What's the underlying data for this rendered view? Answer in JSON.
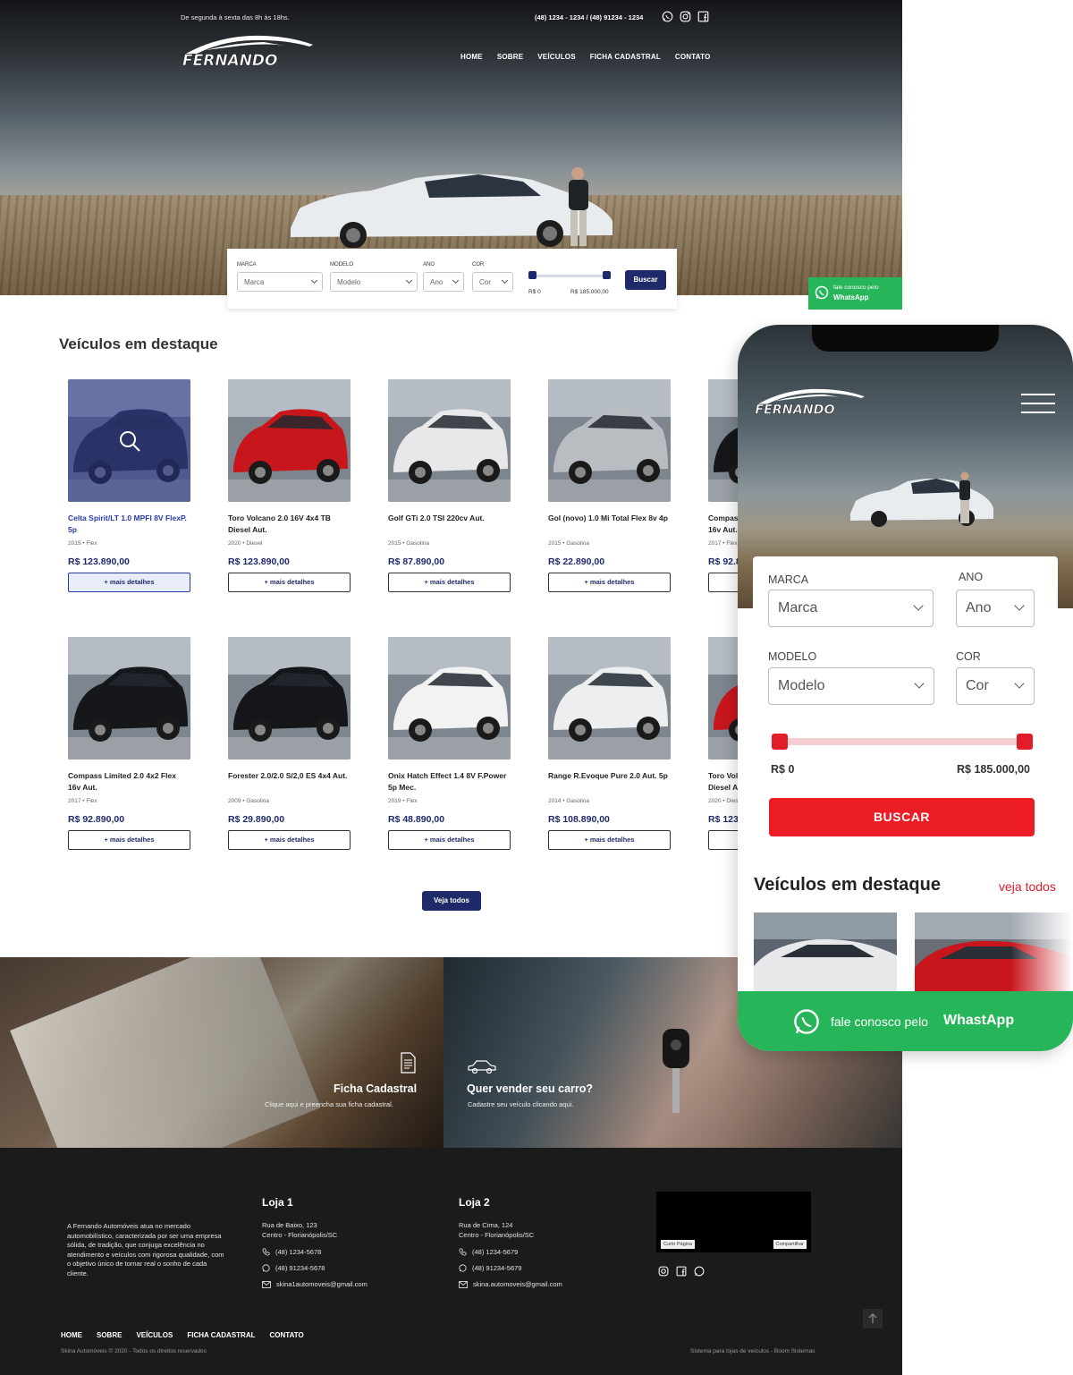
{
  "header": {
    "hours": "De segunda à sexta das 8h às 18hs.",
    "phones": "(48) 1234 - 1234 / (48) 91234 - 1234",
    "social_icons": [
      "whatsapp-icon",
      "instagram-icon",
      "facebook-icon"
    ],
    "logo_text": "FERNANDO",
    "nav": [
      "HOME",
      "SOBRE",
      "VEÍCULOS",
      "FICHA CADASTRAL",
      "CONTATO"
    ]
  },
  "search": {
    "marca_label": "MARCA",
    "marca_value": "Marca",
    "modelo_label": "MODELO",
    "modelo_value": "Modelo",
    "ano_label": "ANO",
    "ano_value": "Ano",
    "cor_label": "COR",
    "cor_value": "Cor",
    "price_min": "R$ 0",
    "price_max": "R$ 185.000,00",
    "button": "Buscar"
  },
  "whatsapp": {
    "line1": "fale conosco pelo",
    "line2": "WhatsApp"
  },
  "featured": {
    "title": "Veículos em destaque",
    "details_label": "+ mais detalhes",
    "view_all": "Veja todos",
    "cars": [
      {
        "name": "Celta Spirit/LT 1.0 MPFI 8V FlexP. 5p",
        "meta": "2015 • Flex",
        "price": "R$ 123.890,00",
        "color": "#2b2f3a"
      },
      {
        "name": "Toro Volcano 2.0 16V 4x4 TB Diesel Aut.",
        "meta": "2020 • Diesel",
        "price": "R$ 123.890,00",
        "color": "#c8161d"
      },
      {
        "name": "Golf GTi 2.0 TSI 220cv Aut.",
        "meta": "2015 • Gasolina",
        "price": "R$ 87.890,00",
        "color": "#e8e8ea"
      },
      {
        "name": "Gol (novo) 1.0 Mi Total Flex 8v 4p",
        "meta": "2015 • Gasolina",
        "price": "R$ 22.890,00",
        "color": "#b9bcc0"
      },
      {
        "name": "Compass Limited 2.0 4x2 Flex 16v Aut.",
        "meta": "2017 • Flex",
        "price": "R$ 92.890,00",
        "color": "#16171a"
      },
      {
        "name": "Compass Limited 2.0 4x2 Flex 16v Aut.",
        "meta": "2017 • Flex",
        "price": "R$ 92.890,00",
        "color": "#16171a"
      },
      {
        "name": "Forester 2.0/2.0 S/2,0 ES 4x4 Aut.",
        "meta": "2009 • Gasolina",
        "price": "R$ 29.890,00",
        "color": "#15161a"
      },
      {
        "name": "Onix Hatch Effect 1.4 8V F.Power 5p Mec.",
        "meta": "2019 • Flex",
        "price": "R$ 48.890,00",
        "color": "#f2f2f2"
      },
      {
        "name": "Range R.Evoque Pure 2.0 Aut. 5p",
        "meta": "2014 • Gasolina",
        "price": "R$ 108.890,00",
        "color": "#eceeef"
      },
      {
        "name": "Toro Volcano 2.0 16V 4x4 TB Diesel Aut.",
        "meta": "2020 • Diesel",
        "price": "R$ 123.890,00",
        "color": "#c8161d"
      }
    ]
  },
  "cta": {
    "left_title": "Ficha Cadastral",
    "left_sub": "Clique aqui e preencha sua ficha cadastral.",
    "right_title": "Quer vender seu carro?",
    "right_sub": "Cadastre seu veículo clicando aqui."
  },
  "footer": {
    "about": "A Fernando Automóveis atua no mercado automobilístico, caracterizada por ser uma empresa sólida, de tradição, que conjuga excelência no atendimento e veículos com rigorosa qualidade, com o objetivo único de tornar real o sonho de cada cliente.",
    "store1": {
      "title": "Loja 1",
      "addr1": "Rua de Baixo, 123",
      "addr2": "Centro - Florianópolis/SC",
      "phone": "(48) 1234-5678",
      "whats": "(48) 91234-5678",
      "email": "skina1automoveis@gmail.com"
    },
    "store2": {
      "title": "Loja 2",
      "addr1": "Rua de Cima, 124",
      "addr2": "Centro - Florianópolis/SC",
      "phone": "(48) 1234-5679",
      "whats": "(48) 91234-5679",
      "email": "skina.automoveis@gmail.com"
    },
    "fb_like": "Curtir Página",
    "fb_share": "Compartilhar",
    "nav": [
      "HOME",
      "SOBRE",
      "VEÍCULOS",
      "FICHA CADASTRAL",
      "CONTATO"
    ],
    "copyright": "Skina Automóveis © 2020 - Todos os direitos reservados",
    "system": "Sistema para lojas de veículos - Boom Sistemas"
  },
  "mobile": {
    "marca_label": "MARCA",
    "marca_value": "Marca",
    "ano_label": "ANO",
    "ano_value": "Ano",
    "modelo_label": "MODELO",
    "modelo_value": "Modelo",
    "cor_label": "COR",
    "cor_value": "Cor",
    "price_min": "R$ 0",
    "price_max": "R$ 185.000,00",
    "button": "BUSCAR",
    "featured_title": "Veículos em destaque",
    "view_all": "veja todos",
    "wa_line1": "fale conosco pelo",
    "wa_line2": "WhastApp"
  }
}
